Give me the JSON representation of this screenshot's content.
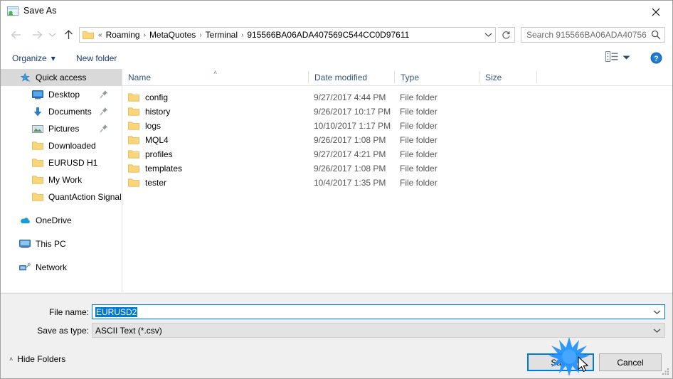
{
  "window": {
    "title": "Save As",
    "title_icon": "save-as-app-icon",
    "close_icon": "close-icon"
  },
  "nav": {
    "back_icon": "arrow-left-icon",
    "forward_icon": "arrow-right-icon",
    "history_icon": "chevron-down-icon",
    "up_icon": "arrow-up-icon",
    "refresh_icon": "refresh-icon"
  },
  "address": {
    "folder_icon": "folder-icon",
    "prefix": "«",
    "crumbs": [
      "Roaming",
      "MetaQuotes",
      "Terminal",
      "915566BA06ADA407569C544CC0D97611"
    ],
    "separator": "›",
    "dropdown_icon": "chevron-down-icon"
  },
  "search": {
    "placeholder": "Search 915566BA06ADA40756...",
    "icon": "search-icon"
  },
  "toolbar": {
    "organize_label": "Organize",
    "organize_caret": "▾",
    "new_folder_label": "New folder",
    "view_icon": "list-view-icon",
    "view_caret_icon": "chevron-down-icon",
    "help_icon": "help-icon",
    "help_glyph": "?"
  },
  "sidebar": {
    "items": [
      {
        "label": "Quick access",
        "icon": "star-pin-icon",
        "level": 0,
        "selected": true,
        "pinned": false
      },
      {
        "label": "Desktop",
        "icon": "desktop-icon",
        "level": 1,
        "selected": false,
        "pinned": true
      },
      {
        "label": "Documents",
        "icon": "documents-download-icon",
        "level": 1,
        "selected": false,
        "pinned": true
      },
      {
        "label": "Pictures",
        "icon": "pictures-icon",
        "level": 1,
        "selected": false,
        "pinned": true
      },
      {
        "label": "Downloaded",
        "icon": "folder-icon",
        "level": 1,
        "selected": false,
        "pinned": false
      },
      {
        "label": "EURUSD H1",
        "icon": "folder-icon",
        "level": 1,
        "selected": false,
        "pinned": false
      },
      {
        "label": "My Work",
        "icon": "folder-icon",
        "level": 1,
        "selected": false,
        "pinned": false
      },
      {
        "label": "QuantAction Signal",
        "icon": "folder-icon",
        "level": 1,
        "selected": false,
        "pinned": false
      },
      {
        "label": "OneDrive",
        "icon": "onedrive-cloud-icon",
        "level": 0,
        "selected": false,
        "pinned": false,
        "gap_before": true
      },
      {
        "label": "This PC",
        "icon": "this-pc-icon",
        "level": 0,
        "selected": false,
        "pinned": false,
        "gap_before": true
      },
      {
        "label": "Network",
        "icon": "network-icon",
        "level": 0,
        "selected": false,
        "pinned": false,
        "gap_before": true
      }
    ]
  },
  "filelist": {
    "columns": [
      "Name",
      "Date modified",
      "Type",
      "Size"
    ],
    "sort_indicator": "˄",
    "rows": [
      {
        "name": "config",
        "date": "9/27/2017 4:44 PM",
        "type": "File folder",
        "size": "",
        "icon": "folder-icon"
      },
      {
        "name": "history",
        "date": "9/26/2017 10:17 PM",
        "type": "File folder",
        "size": "",
        "icon": "folder-icon"
      },
      {
        "name": "logs",
        "date": "10/10/2017 1:17 PM",
        "type": "File folder",
        "size": "",
        "icon": "folder-icon"
      },
      {
        "name": "MQL4",
        "date": "9/26/2017 1:08 PM",
        "type": "File folder",
        "size": "",
        "icon": "folder-icon"
      },
      {
        "name": "profiles",
        "date": "9/27/2017 4:21 PM",
        "type": "File folder",
        "size": "",
        "icon": "folder-icon"
      },
      {
        "name": "templates",
        "date": "9/26/2017 1:08 PM",
        "type": "File folder",
        "size": "",
        "icon": "folder-icon"
      },
      {
        "name": "tester",
        "date": "10/4/2017 1:35 PM",
        "type": "File folder",
        "size": "",
        "icon": "folder-icon"
      }
    ]
  },
  "form": {
    "filename_label": "File name:",
    "filename_value": "EURUSD2",
    "filename_selected": true,
    "filetype_label": "Save as type:",
    "filetype_value": "ASCII Text (*.csv)",
    "dropdown_icon": "chevron-down-icon"
  },
  "footer": {
    "hide_folders_label": "Hide Folders",
    "hide_folders_caret": "˄",
    "save_label": "Save",
    "cancel_label": "Cancel",
    "resize_grip_icon": "resize-grip-icon"
  },
  "interaction": {
    "click_burst_icon": "click-burst-icon",
    "cursor_icon": "mouse-pointer-icon"
  },
  "colors": {
    "accent": "#0078d7",
    "header_text": "#34557c",
    "toolbar_link": "#1a3c6e",
    "folder_yellow": "#ffd172",
    "selection_grey": "#d9d9d9",
    "dialog_bg": "#f0f0f0"
  }
}
